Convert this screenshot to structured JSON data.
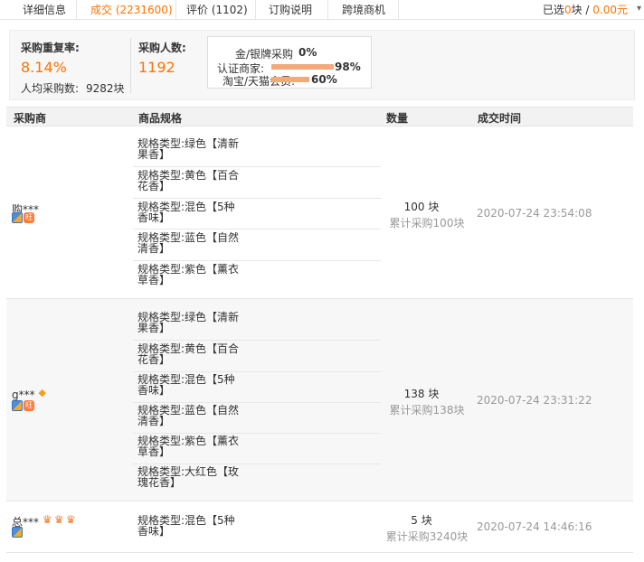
{
  "tabs": [
    {
      "label": "详细信息"
    },
    {
      "label": "成交 (2231600)"
    },
    {
      "label": "评价 (1102)"
    },
    {
      "label": "订购说明"
    },
    {
      "label": "跨境商机"
    }
  ],
  "selection": {
    "prefix": "已选",
    "count": "0",
    "unit": "块",
    "sep": " / ",
    "amount": "0.00",
    "currency": "元",
    "caret": "▾"
  },
  "stats": {
    "repeat_rate_label": "采购重复率:",
    "repeat_rate_value": "8.14%",
    "avg_label": "人均采购数:",
    "avg_value": "9282块",
    "buyers_label": "采购人数:",
    "buyers_value": "1192",
    "breakdown": [
      {
        "label": "金/银牌采购",
        "pct": "0%",
        "fraction": 0.0
      },
      {
        "label": "认证商家:",
        "pct": "98%",
        "fraction": 0.98
      },
      {
        "label": "淘宝/天猫会员:",
        "pct": "60%",
        "fraction": 0.6
      }
    ]
  },
  "table": {
    "headers": [
      "采购商",
      "商品规格",
      "数量",
      "成交时间"
    ],
    "rows": [
      {
        "buyer": "购***",
        "specs": [
          "规格类型:绿色【清新果香】",
          "规格类型:黄色【百合花香】",
          "规格类型:混色【5种香味】",
          "规格类型:蓝色【自然清香】",
          "规格类型:紫色【薰衣草香】"
        ],
        "qty": "100 块",
        "total": "累计采购100块",
        "time": "2020-07-24 23:54:08"
      },
      {
        "buyer": "g***",
        "specs": [
          "规格类型:绿色【清新果香】",
          "规格类型:黄色【百合花香】",
          "规格类型:混色【5种香味】",
          "规格类型:蓝色【自然清香】",
          "规格类型:紫色【薰衣草香】",
          "规格类型:大红色【玫瑰花香】"
        ],
        "qty": "138 块",
        "total": "累计采购138块",
        "time": "2020-07-24 23:31:22"
      },
      {
        "buyer": "总***",
        "specs": [
          "规格类型:混色【5种香味】"
        ],
        "qty": "5 块",
        "total": "累计采购3240块",
        "time": "2020-07-24 14:46:16"
      }
    ]
  },
  "icons": {
    "shop_badge_text": "旺"
  }
}
